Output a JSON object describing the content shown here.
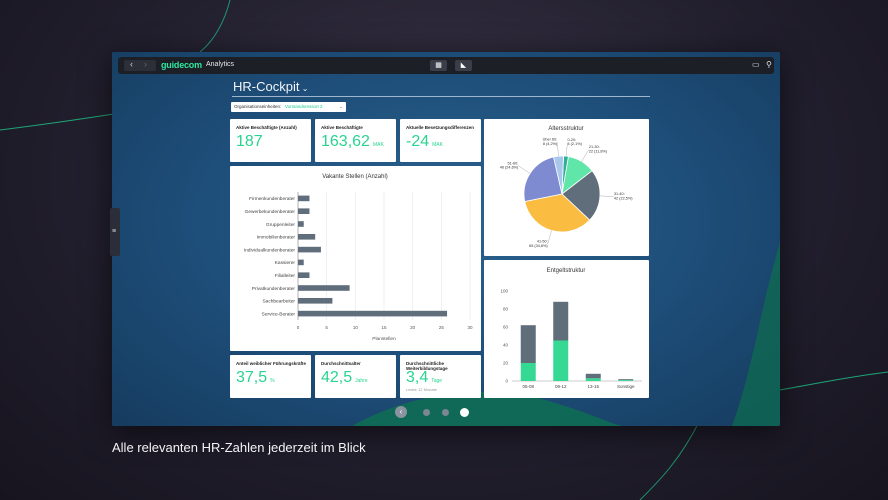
{
  "caption": "Alle relevanten HR-Zahlen jederzeit im Blick",
  "topbar": {
    "logo": "guidecom",
    "app_title": "Analytics",
    "back_icon": "chevron-left-icon",
    "forward_icon": "chevron-right-icon"
  },
  "page": {
    "title": "HR-Cockpit",
    "org_label": "Organisationseinheiten:",
    "org_value": "Vorstandsressort 2"
  },
  "kpis_top": [
    {
      "label": "Aktive Beschäftigte (Anzahl)",
      "value": "187",
      "unit": ""
    },
    {
      "label": "Aktive Beschäftigte",
      "value": "163,62",
      "unit": "MAK"
    },
    {
      "label": "Aktuelle Besetzungsdifferenzen",
      "value": "-24",
      "unit": "MAK"
    }
  ],
  "kpis_bottom": [
    {
      "label": "Anteil weiblicher Führungskräfte",
      "value": "37,5",
      "unit": "%",
      "sub": ""
    },
    {
      "label": "Durchschnittsalter",
      "value": "42,5",
      "unit": "Jahre",
      "sub": ""
    },
    {
      "label": "Durchschnittliche Weiterbildungstage",
      "value": "3,4",
      "unit": "Tage",
      "sub": "Letzte 12 Monate"
    }
  ],
  "colors": {
    "accent": "#28d48f",
    "bar": "#5f6e7a",
    "screen": "#1d4d78"
  },
  "chart_data": [
    {
      "type": "bar",
      "orientation": "horizontal",
      "title": "Vakante Stellen (Anzahl)",
      "xlabel": "Planstellen",
      "categories": [
        "Firmenkundenberater",
        "Gewerbekundenberater",
        "Gruppenleiter",
        "Immobilienberater",
        "Individualkundenberater",
        "Kassierer",
        "Filialleiter",
        "Privatkundenberater",
        "Sachbearbeiter",
        "Service-Berater"
      ],
      "values": [
        2,
        2,
        1,
        3,
        4,
        1,
        2,
        9,
        6,
        26
      ],
      "xlim": [
        0,
        30
      ],
      "xticks": [
        0,
        5,
        10,
        15,
        20,
        25,
        30
      ],
      "grid": true
    },
    {
      "type": "pie",
      "title": "Altersstruktur",
      "slices": [
        {
          "label": "0-20",
          "value_label": "4 (2,1%)",
          "percent": 2.1,
          "color": "#2fae9a"
        },
        {
          "label": "21-30",
          "value_label": "22 (11,8%)",
          "percent": 11.8,
          "color": "#5fe6a8"
        },
        {
          "label": "31-40",
          "value_label": "42 (22,5%)",
          "percent": 22.5,
          "color": "#5f6e7a"
        },
        {
          "label": "41-50",
          "value_label": "65 (34,8%)",
          "percent": 34.8,
          "color": "#fbbd41"
        },
        {
          "label": "51-60",
          "value_label": "46 (24,6%)",
          "percent": 24.6,
          "color": "#7f8bd1"
        },
        {
          "label": "Über 60",
          "value_label": "8 (4,2%)",
          "percent": 4.2,
          "color": "#a9c6ec"
        }
      ]
    },
    {
      "type": "bar",
      "stacked": true,
      "title": "Entgeltstruktur",
      "categories": [
        "05-08",
        "09-12",
        "13-15",
        "Sonstige"
      ],
      "series": [
        {
          "values": [
            20,
            45,
            3,
            1
          ],
          "color": "#36d993"
        },
        {
          "values": [
            42,
            43,
            5,
            1
          ],
          "color": "#5f6e7a"
        }
      ],
      "ylim": [
        0,
        100
      ],
      "yticks": [
        0,
        20,
        40,
        60,
        80,
        100
      ]
    }
  ]
}
